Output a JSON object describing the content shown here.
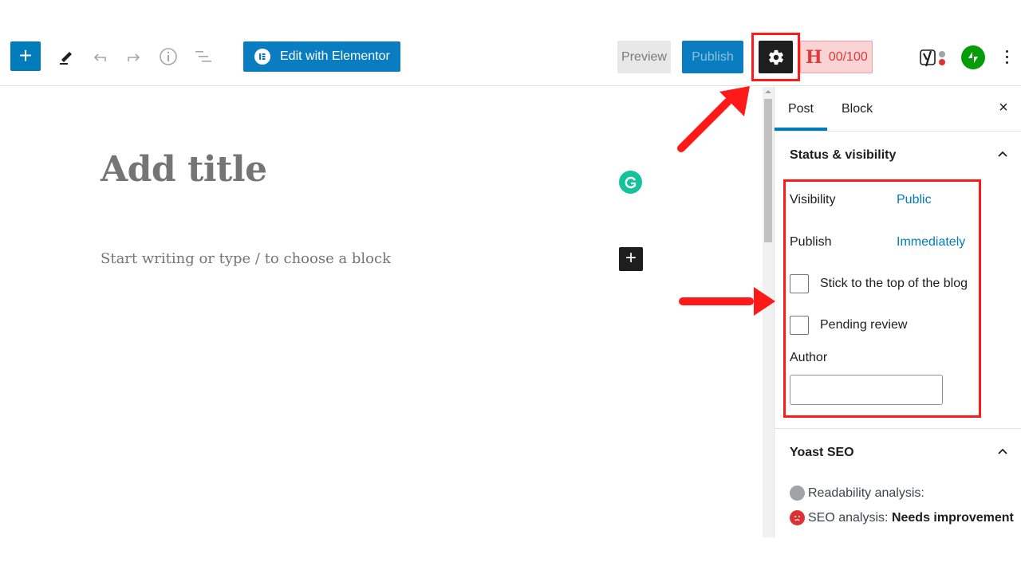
{
  "toolbar": {
    "inserter_label": "+",
    "tool_icons": [
      "pencil-icon",
      "undo-icon",
      "redo-icon",
      "info-icon",
      "list-view-icon"
    ],
    "elementor_label": "Edit with Elementor",
    "preview_label": "Preview",
    "publish_label": "Publish",
    "settings_icon": "gear-icon",
    "headline_score": "00/100",
    "headline_letter": "H",
    "plugins": [
      "yoast-icon",
      "jetpack-icon"
    ],
    "more_icon": "more-vertical-icon"
  },
  "editor": {
    "title_placeholder": "Add title",
    "block_placeholder": "Start writing or type / to choose a block",
    "add_block_label": "+"
  },
  "sidebar": {
    "tabs": [
      {
        "label": "Post",
        "active": true
      },
      {
        "label": "Block",
        "active": false
      }
    ],
    "close_label": "×",
    "status_panel": {
      "title": "Status & visibility",
      "visibility_label": "Visibility",
      "visibility_value": "Public",
      "publish_label": "Publish",
      "publish_value": "Immediately",
      "sticky_label": "Stick to the top of the blog",
      "sticky_checked": false,
      "pending_label": "Pending review",
      "pending_checked": false,
      "author_label": "Author",
      "author_value": ""
    },
    "yoast_panel": {
      "title": "Yoast SEO",
      "readability_label": "Readability analysis:",
      "seo_label": "SEO analysis: ",
      "seo_value": "Needs improvement"
    }
  },
  "colors": {
    "accent": "#007cba",
    "annotation": "#ff1a1a",
    "headline_score_bg": "#fad4d4",
    "jetpack": "#069e08",
    "grammarly": "#15c39a",
    "seo_bad": "#dc3232"
  }
}
